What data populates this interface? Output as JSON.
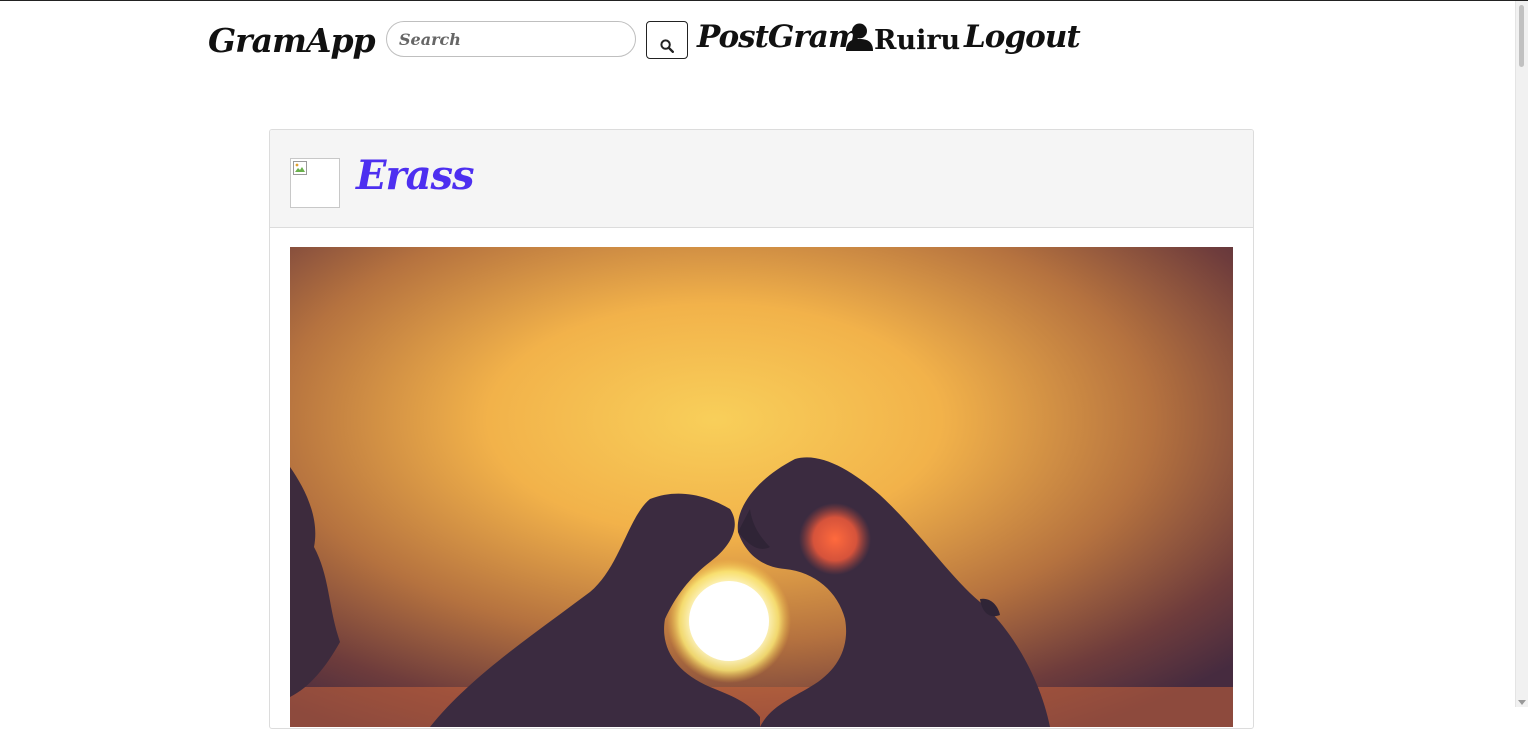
{
  "navbar": {
    "brand": "GramApp",
    "search": {
      "placeholder": "Search",
      "value": ""
    },
    "search_icon": "search-icon",
    "links": {
      "postgram": "PostGram",
      "profile": "Ruiru",
      "profile_icon": "user-icon",
      "logout": "Logout"
    }
  },
  "post": {
    "username": "Erass",
    "avatar": "broken-image",
    "image": "sunset-heart-hands-photo"
  },
  "colors": {
    "username": "#4d2ff0",
    "text": "#111111",
    "card_header_bg": "#f5f5f5"
  }
}
